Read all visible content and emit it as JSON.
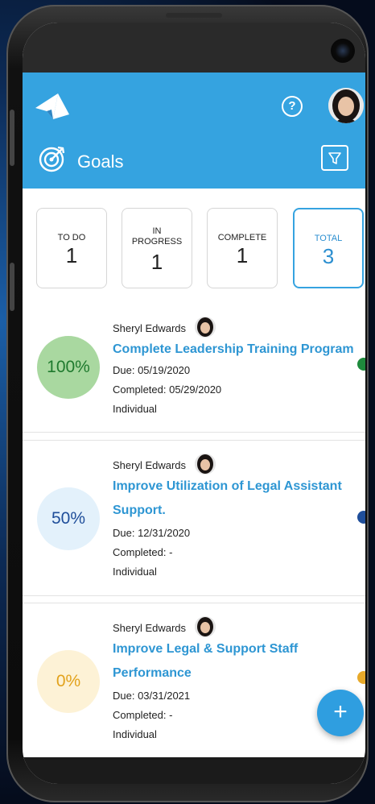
{
  "header": {
    "title": "Goals",
    "help_label": "?",
    "logo_icon": "paper-plane-logo",
    "filter_icon": "filter-icon",
    "accent": "#35a3e0"
  },
  "stats": [
    {
      "label_line1": "TO DO",
      "label_line2": "",
      "value": "1"
    },
    {
      "label_line1": "IN",
      "label_line2": "PROGRESS",
      "value": "1"
    },
    {
      "label_line1": "COMPLETE",
      "label_line2": "",
      "value": "1"
    },
    {
      "label_line1": "TOTAL",
      "label_line2": "",
      "value": "3"
    }
  ],
  "goals": [
    {
      "owner": "Sheryl Edwards",
      "title_line1": "Complete Leadership Training Program",
      "title_line2": "",
      "due": "Due: 05/19/2020",
      "completed": "Completed: 05/29/2020",
      "type": "Individual",
      "percent": "100%",
      "status_color": "#1e8a3c"
    },
    {
      "owner": "Sheryl Edwards",
      "title_line1": "Improve Utilization of Legal Assistant",
      "title_line2": "Support.",
      "due": "Due: 12/31/2020",
      "completed": "Completed: -",
      "type": "Individual",
      "percent": "50%",
      "status_color": "#1f4e9a"
    },
    {
      "owner": "Sheryl Edwards",
      "title_line1": "Improve Legal & Support Staff",
      "title_line2": "Performance",
      "due": "Due: 03/31/2021",
      "completed": "Completed: -",
      "type": "Individual",
      "percent": "0%",
      "status_color": "#e7a92a"
    }
  ],
  "fab_label": "+"
}
